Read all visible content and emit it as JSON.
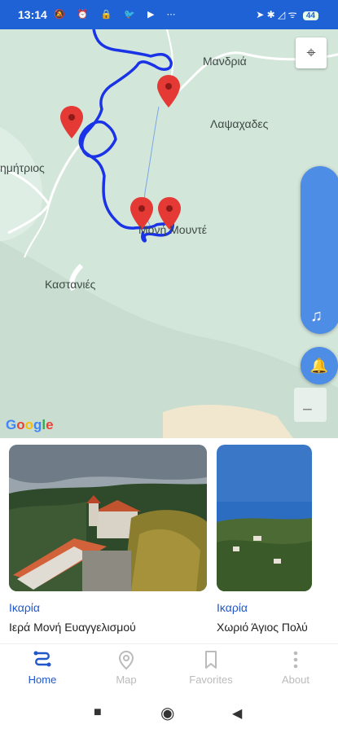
{
  "status_bar": {
    "time": "13:14",
    "left_icons": "🔕 ⏰ 🔒 🐦 ▶ ⋯",
    "right_icons": "➤ ✱ ◿ ᯤ",
    "battery": "44"
  },
  "map": {
    "places": {
      "mandria": "Μανδριά",
      "lapsachades": "Λαψαχαδες",
      "dimitrios": "ημήτριος",
      "moni_mounte": "Μονή Μουντέ",
      "kastanies": "Καστανιές"
    },
    "google_logo": [
      "G",
      "o",
      "o",
      "g",
      "l",
      "e"
    ],
    "colors": {
      "route": "#1a33e6",
      "marker": "#e53935",
      "water": "#cfe3d6"
    }
  },
  "cards": [
    {
      "region": "Ικαρία",
      "title": "Ιερά Μονή Ευαγγελισμού"
    },
    {
      "region": "Ικαρία",
      "title": "Χωριό Άγιος Πολύ"
    }
  ],
  "nav": {
    "home": "Home",
    "map": "Map",
    "favorites": "Favorites",
    "about": "About"
  },
  "accent": "#2157c9"
}
